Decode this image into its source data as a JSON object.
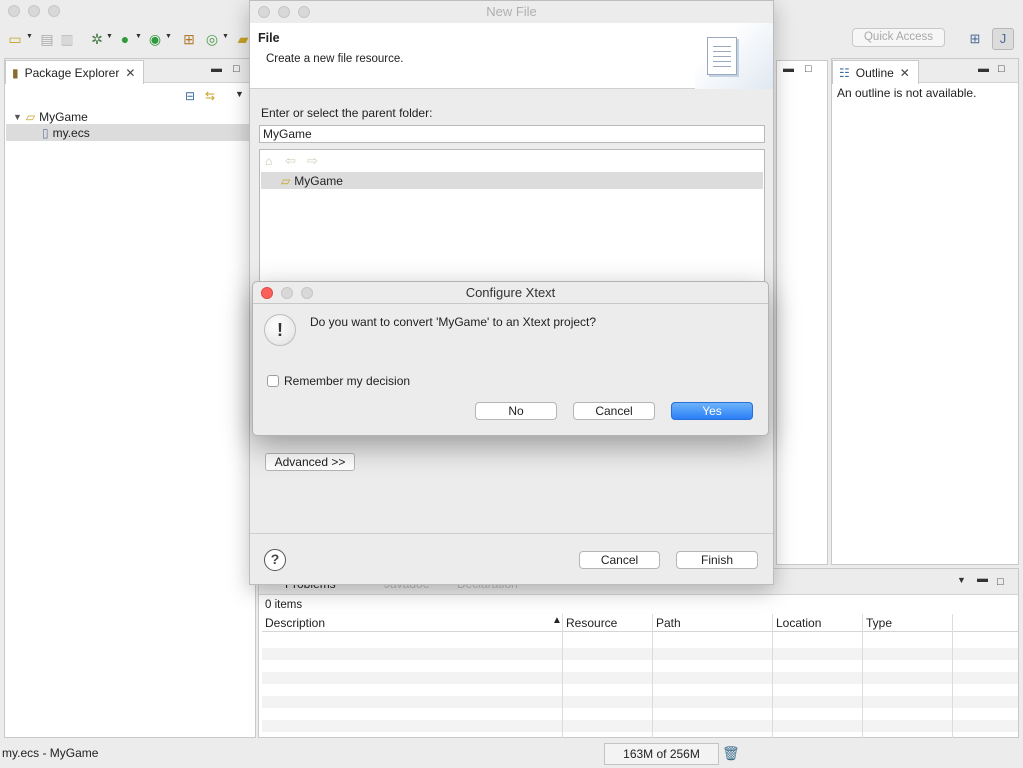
{
  "toolbar": {
    "quick_access": "Quick Access"
  },
  "package_explorer": {
    "tab_label": "Package Explorer",
    "tree": [
      {
        "label": "MyGame",
        "icon": "project-folder-icon"
      },
      {
        "label": "my.ecs",
        "icon": "file-icon"
      }
    ]
  },
  "outline": {
    "tab_label": "Outline",
    "message": "An outline is not available."
  },
  "problems": {
    "tabs": [
      "Problems",
      "Javadoc",
      "Declaration"
    ],
    "item_count": "0 items",
    "columns": [
      "Description",
      "Resource",
      "Path",
      "Location",
      "Type"
    ]
  },
  "status": {
    "selection": "my.ecs - MyGame",
    "heap": "163M of 256M"
  },
  "new_file_dialog": {
    "title": "New File",
    "heading": "File",
    "message": "Create a new file resource.",
    "parent_label": "Enter or select the parent folder:",
    "parent_value": "MyGame",
    "folders": [
      "MyGame"
    ],
    "advanced_label": "Advanced >>",
    "cancel_label": "Cancel",
    "finish_label": "Finish"
  },
  "xtext_dialog": {
    "title": "Configure Xtext",
    "question": "Do you want to convert 'MyGame' to an Xtext project?",
    "remember_label": "Remember my decision",
    "no_label": "No",
    "cancel_label": "Cancel",
    "yes_label": "Yes"
  },
  "colors": {
    "accent": "#2b7ef5",
    "close_red": "#fc605b"
  }
}
